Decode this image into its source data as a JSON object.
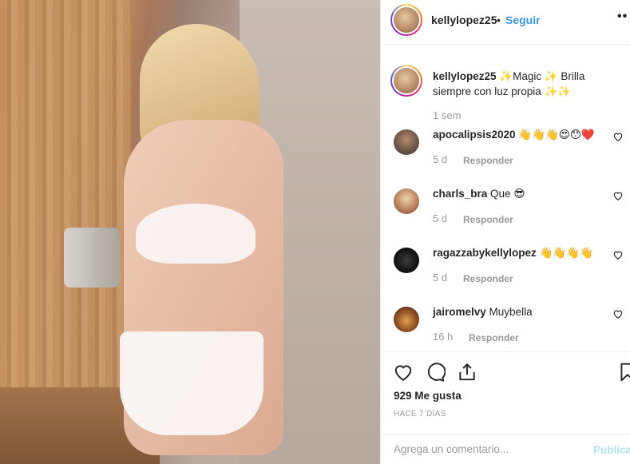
{
  "post": {
    "photo": "image",
    "username": "kellylopez25",
    "separator": "•",
    "follow_label": "Seguir",
    "more_icon": "••"
  },
  "caption": {
    "username": "kellylopez25",
    "text": " ✨Magic ✨ Brilla siempre con luz propia ✨✨",
    "time": "1 sem"
  },
  "comments": [
    {
      "username": "apocalipsis2020",
      "text": " 👋👋👋😍😯❤️",
      "time": "5 d",
      "reply": "Responder"
    },
    {
      "username": "charls_bra",
      "text": " Que 😎",
      "time": "5 d",
      "reply": "Responder"
    },
    {
      "username": "ragazzabykellylopez",
      "text": " 👋👋👋👋",
      "time": "5 d",
      "reply": "Responder"
    },
    {
      "username": "jairomelvy",
      "text": " Muybella",
      "time": "16 h",
      "reply": "Responder"
    }
  ],
  "actions": {
    "likes": "929 Me gusta",
    "ago": "HACE 7 DÍAS"
  },
  "add_comment": {
    "placeholder": "Agrega un comentario...",
    "post_label": "Publicar"
  },
  "colors": {
    "accent": "#3897f0",
    "muted": "#999999",
    "post_disabled": "#b2dffc"
  }
}
